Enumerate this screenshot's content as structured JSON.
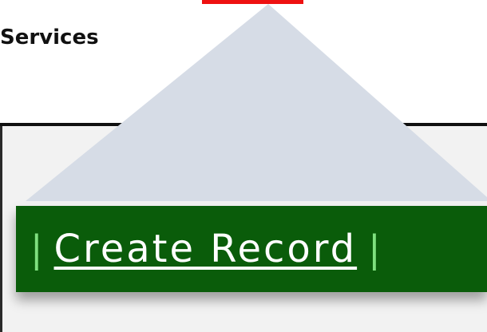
{
  "header": {
    "title_fragment": "Services"
  },
  "nav": {
    "separator": "|",
    "links": [
      {
        "label": "Create Record"
      }
    ]
  },
  "colors": {
    "navbar_bg": "#0a5c0a",
    "separator": "#7fe07f",
    "callout_fill": "#d6dce6",
    "marker": "#ee1111"
  }
}
